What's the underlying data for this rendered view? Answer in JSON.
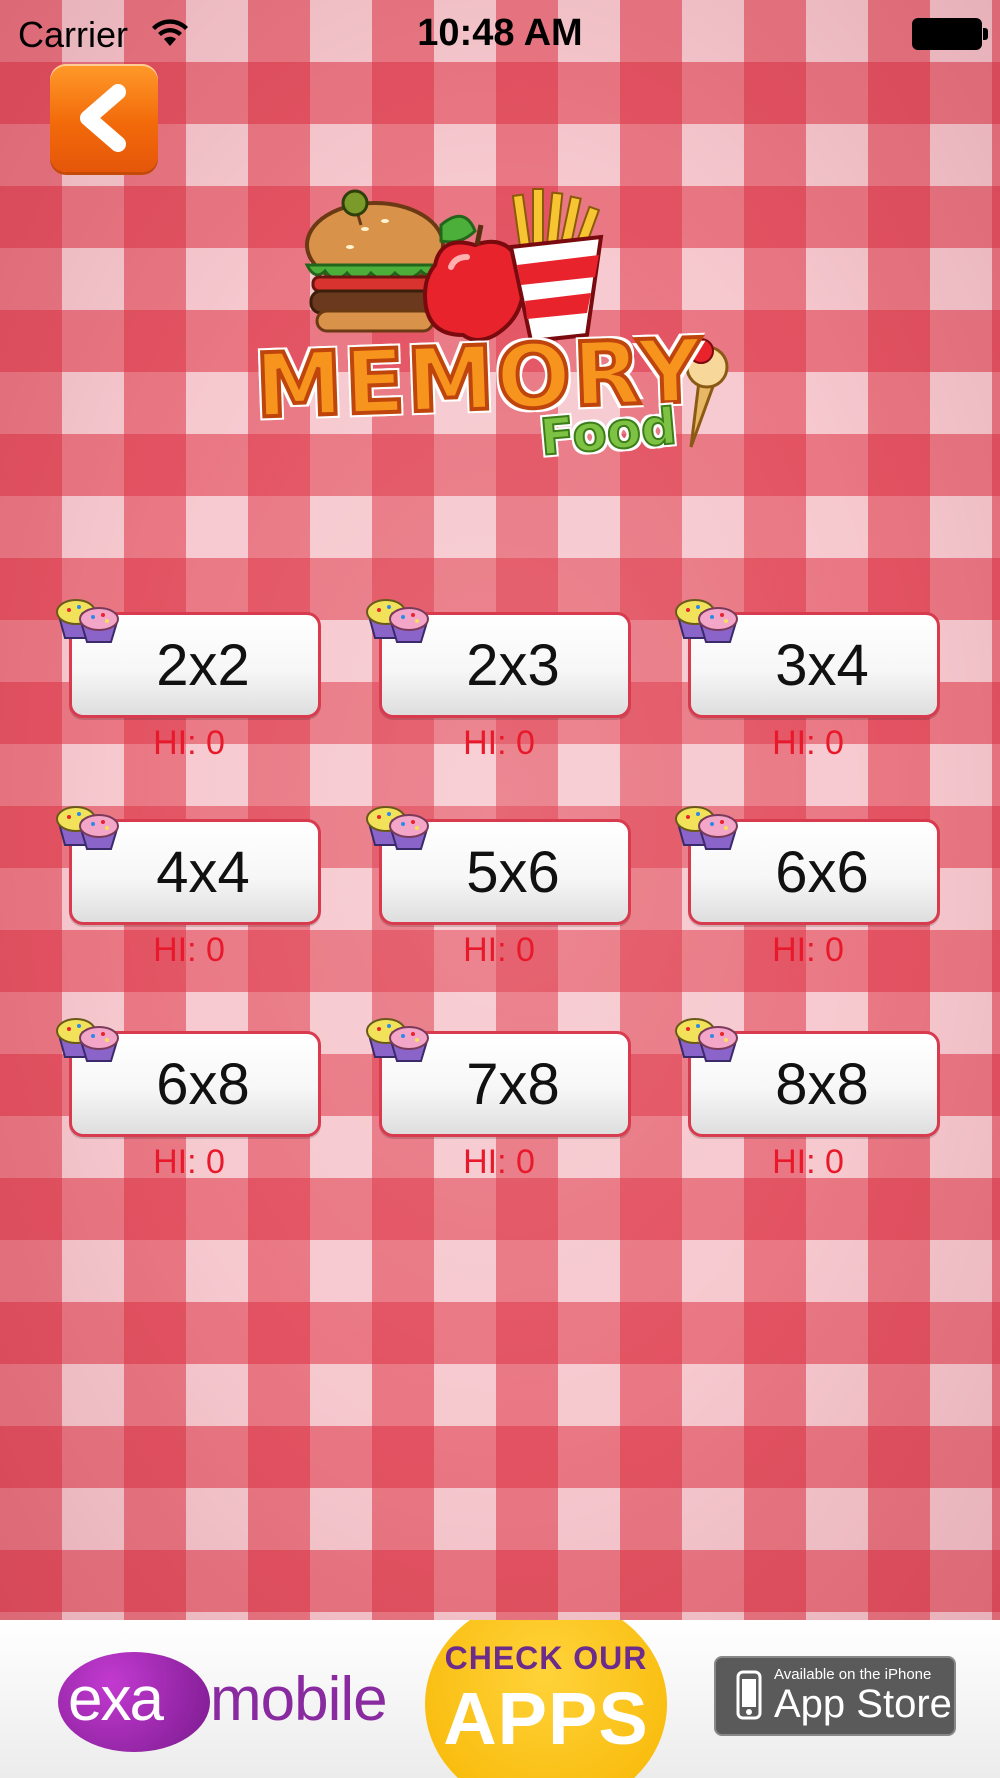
{
  "status_bar": {
    "carrier": "Carrier",
    "time": "10:48 AM"
  },
  "logo": {
    "title": "MEMORY",
    "subtitle": "Food"
  },
  "levels": [
    {
      "label": "2x2",
      "hi": "HI: 0"
    },
    {
      "label": "2x3",
      "hi": "HI: 0"
    },
    {
      "label": "3x4",
      "hi": "HI: 0"
    },
    {
      "label": "4x4",
      "hi": "HI: 0"
    },
    {
      "label": "5x6",
      "hi": "HI: 0"
    },
    {
      "label": "6x6",
      "hi": "HI: 0"
    },
    {
      "label": "6x8",
      "hi": "HI: 0"
    },
    {
      "label": "7x8",
      "hi": "HI: 0"
    },
    {
      "label": "8x8",
      "hi": "HI: 0"
    }
  ],
  "ad": {
    "brand_exa": "exa",
    "brand_mobile": "mobile",
    "cta_line1": "CHECK OUR",
    "cta_line2": "APPS",
    "store_small": "Available on the iPhone",
    "store_big": "App Store"
  },
  "colors": {
    "checker_red": "#de3446",
    "back_button": "#f26a0a",
    "hi_score": "#e8192a",
    "button_border": "#d83a4e"
  }
}
